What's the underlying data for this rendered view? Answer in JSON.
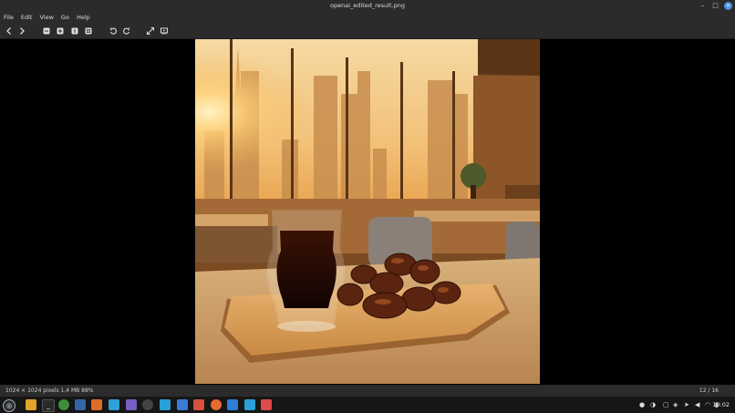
{
  "window": {
    "title": "openai_edited_result.png"
  },
  "menu": [
    "File",
    "Edit",
    "View",
    "Go",
    "Help"
  ],
  "toolbar": {
    "icons": [
      "back-icon",
      "forward-icon",
      "zoom-out-icon",
      "zoom-in-icon",
      "zoom-1to1-icon",
      "zoom-fit-icon",
      "rotate-left-icon",
      "rotate-right-icon",
      "fullscreen-icon",
      "slideshow-icon"
    ]
  },
  "status": {
    "info": "1024 × 1024 pixels  1,4 MB   88%",
    "counter": "12 / 16"
  },
  "taskbar": {
    "clock": "19:02",
    "apps": [
      "menu-icon",
      "files-icon",
      "terminal-icon",
      "chrome-icon",
      "app-icon",
      "brave-icon",
      "vs-icon",
      "app-icon",
      "settings-icon",
      "telegram-icon",
      "docs-icon",
      "app-icon",
      "firefox-icon",
      "vscode-icon",
      "telegram-icon",
      "image-viewer-icon"
    ]
  },
  "colors": {
    "chrome_bg": "#2b2b2b",
    "accent": "#4a90e2",
    "taskbar_bg": "#161616"
  }
}
